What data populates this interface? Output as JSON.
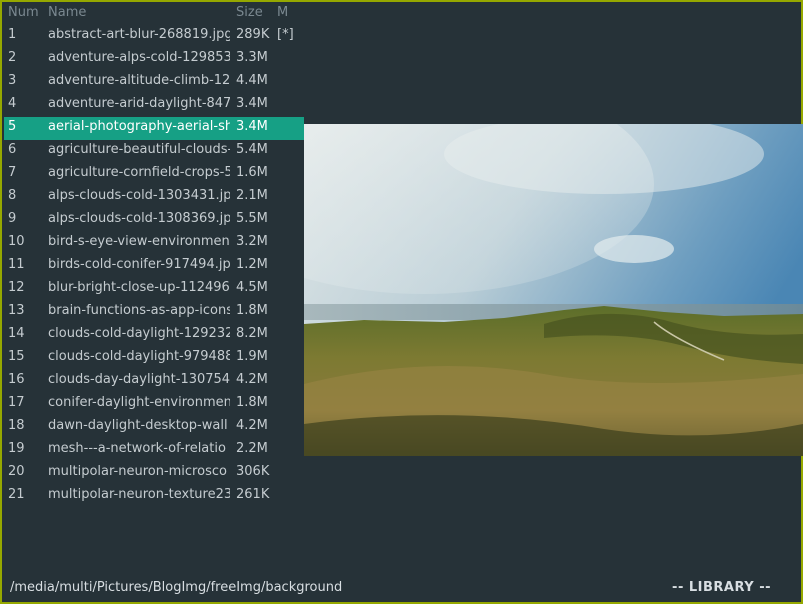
{
  "header": {
    "num": "Num",
    "name": "Name",
    "size": "Size",
    "mark": "M"
  },
  "files": [
    {
      "num": "1",
      "name": "abstract-art-blur-268819.jpg",
      "size": "289K",
      "mark": "[*]"
    },
    {
      "num": "2",
      "name": "adventure-alps-cold-129853",
      "size": "3.3M",
      "mark": ""
    },
    {
      "num": "3",
      "name": "adventure-altitude-climb-12",
      "size": "4.4M",
      "mark": ""
    },
    {
      "num": "4",
      "name": "adventure-arid-daylight-847",
      "size": "3.4M",
      "mark": ""
    },
    {
      "num": "5",
      "name": "aerial-photography-aerial-sh",
      "size": "3.4M",
      "mark": ""
    },
    {
      "num": "6",
      "name": "agriculture-beautiful-clouds-",
      "size": "5.4M",
      "mark": ""
    },
    {
      "num": "7",
      "name": "agriculture-cornfield-crops-5",
      "size": "1.6M",
      "mark": ""
    },
    {
      "num": "8",
      "name": "alps-clouds-cold-1303431.jp",
      "size": "2.1M",
      "mark": ""
    },
    {
      "num": "9",
      "name": "alps-clouds-cold-1308369.jp",
      "size": "5.5M",
      "mark": ""
    },
    {
      "num": "10",
      "name": "bird-s-eye-view-environmen",
      "size": "3.2M",
      "mark": ""
    },
    {
      "num": "11",
      "name": "birds-cold-conifer-917494.jp",
      "size": "1.2M",
      "mark": ""
    },
    {
      "num": "12",
      "name": "blur-bright-close-up-112496",
      "size": "4.5M",
      "mark": ""
    },
    {
      "num": "13",
      "name": "brain-functions-as-app-icons",
      "size": "1.8M",
      "mark": ""
    },
    {
      "num": "14",
      "name": "clouds-cold-daylight-129232",
      "size": "8.2M",
      "mark": ""
    },
    {
      "num": "15",
      "name": "clouds-cold-daylight-979488",
      "size": "1.9M",
      "mark": ""
    },
    {
      "num": "16",
      "name": "clouds-day-daylight-130754",
      "size": "4.2M",
      "mark": ""
    },
    {
      "num": "17",
      "name": "conifer-daylight-environmen",
      "size": "1.8M",
      "mark": ""
    },
    {
      "num": "18",
      "name": "dawn-daylight-desktop-wall",
      "size": "4.2M",
      "mark": ""
    },
    {
      "num": "19",
      "name": "mesh---a-network-of-relatio",
      "size": "2.2M",
      "mark": ""
    },
    {
      "num": "20",
      "name": "multipolar-neuron-microsco",
      "size": "306K",
      "mark": ""
    },
    {
      "num": "21",
      "name": "multipolar-neuron-texture23",
      "size": "261K",
      "mark": ""
    }
  ],
  "selected_index": 4,
  "status": {
    "path": "/media/multi/Pictures/BlogImg/freeImg/background",
    "mode": "-- LIBRARY --"
  },
  "colors": {
    "frame": "#95a800",
    "background": "#263238",
    "selection": "#16a085"
  }
}
